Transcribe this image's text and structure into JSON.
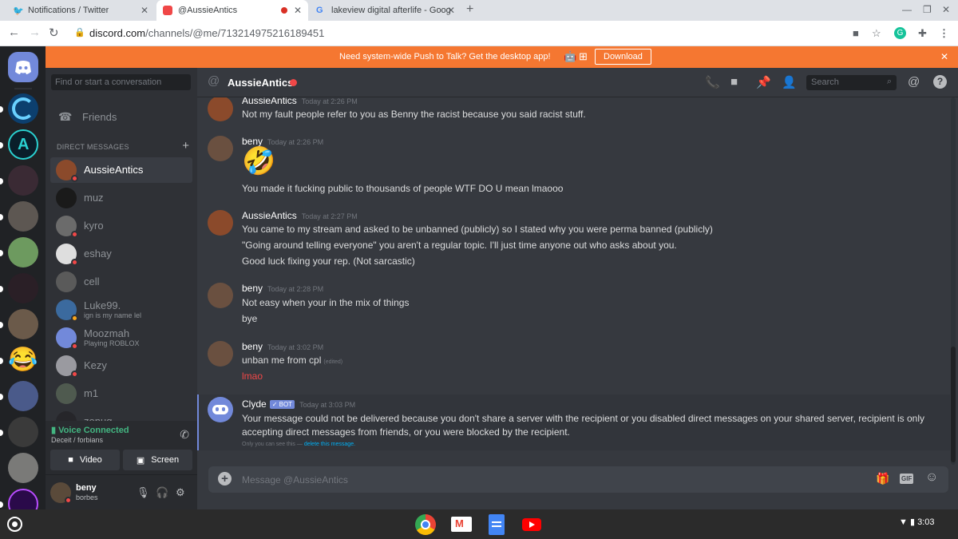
{
  "browser": {
    "tabs": [
      {
        "label": "Notifications / Twitter",
        "favicon": "twitter-icon",
        "active": false
      },
      {
        "label": "@AussieAntics",
        "favicon": "discord-icon",
        "active": true
      },
      {
        "label": "lakeview digital afterlife - Google",
        "favicon": "google-icon",
        "active": false
      }
    ],
    "url_host": "discord.com",
    "url_path": "/channels/@me/713214975216189451"
  },
  "notice": {
    "text": "Need system-wide Push to Talk? Get the desktop app!",
    "download_label": "Download"
  },
  "sidebar": {
    "search_placeholder": "Find or start a conversation",
    "friends_label": "Friends",
    "dm_header": "DIRECT MESSAGES",
    "dms": [
      {
        "name": "AussieAntics",
        "sub": "",
        "status": "#f04747",
        "avatar": "#8b4a2b",
        "active": true
      },
      {
        "name": "muz",
        "sub": "",
        "status": "",
        "avatar": "#1a1a1a",
        "active": false
      },
      {
        "name": "kyro",
        "sub": "",
        "status": "#f04747",
        "avatar": "#6b6b6b",
        "active": false
      },
      {
        "name": "eshay",
        "sub": "",
        "status": "#f04747",
        "avatar": "#dedede",
        "active": false
      },
      {
        "name": "cell",
        "sub": "",
        "status": "",
        "avatar": "#5a5a5a",
        "active": false
      },
      {
        "name": "Luke99.",
        "sub": "ign is my name lel",
        "status": "#faa61a",
        "avatar": "#3b6a9e",
        "active": false
      },
      {
        "name": "Moozmah",
        "sub": "Playing ROBLOX",
        "status": "#f04747",
        "avatar": "#7289da",
        "active": false
      },
      {
        "name": "Kezy",
        "sub": "",
        "status": "#f04747",
        "avatar": "#9a9aa0",
        "active": false
      },
      {
        "name": "m1",
        "sub": "",
        "status": "",
        "avatar": "#4f5a4f",
        "active": false
      },
      {
        "name": "zonug",
        "sub": "",
        "status": "",
        "avatar": "#26262a",
        "active": false
      }
    ],
    "voice": {
      "status": "Voice Connected",
      "channel": "Deceit / forbians",
      "video_label": "Video",
      "screen_label": "Screen"
    },
    "user": {
      "name": "beny",
      "tag": "borbes"
    }
  },
  "channel": {
    "title": "AussieAntics",
    "search_placeholder": "Search"
  },
  "messages": [
    {
      "author": "AussieAntics",
      "time": "Today at 2:26 PM",
      "lines": [
        "Not my fault people refer to you as Benny the racist because you said racist stuff."
      ]
    },
    {
      "author": "beny",
      "time": "Today at 2:26 PM",
      "emoji": "🤣",
      "lines": [
        "You made it fucking public to thousands of people WTF DO U mean lmaooo"
      ]
    },
    {
      "author": "AussieAntics",
      "time": "Today at 2:27 PM",
      "lines": [
        "You came to my stream and asked to be unbanned (publicly) so I stated why you were perma banned (publicly)",
        "\"Going around telling everyone\" you aren't a regular topic. I'll just time anyone out who asks about you.",
        "Good luck fixing your rep. (Not sarcastic)"
      ]
    },
    {
      "author": "beny",
      "time": "Today at 2:28 PM",
      "lines": [
        "Not easy when your in the mix of things",
        "bye"
      ]
    },
    {
      "author": "beny",
      "time": "Today at 3:02 PM",
      "lines": [
        "unban me from cpl",
        "lmao"
      ],
      "edited": "(edited)"
    }
  ],
  "clyde": {
    "author": "Clyde",
    "badge": "✓ BOT",
    "time": "Today at 3:03 PM",
    "body": "Your message could not be delivered because you don't share a server with the recipient or you disabled direct messages on your shared server, recipient is only accepting direct messages from friends, or you were blocked by the recipient.",
    "only_you": "Only you can see this —",
    "delete_link": "delete this message."
  },
  "composer": {
    "placeholder": "Message @AussieAntics",
    "gif_label": "GIF"
  },
  "shelf": {
    "time": "3:03"
  },
  "colors": {
    "accent": "#7289da",
    "notice": "#f57731",
    "online": "#43b581",
    "dnd": "#f04747"
  }
}
